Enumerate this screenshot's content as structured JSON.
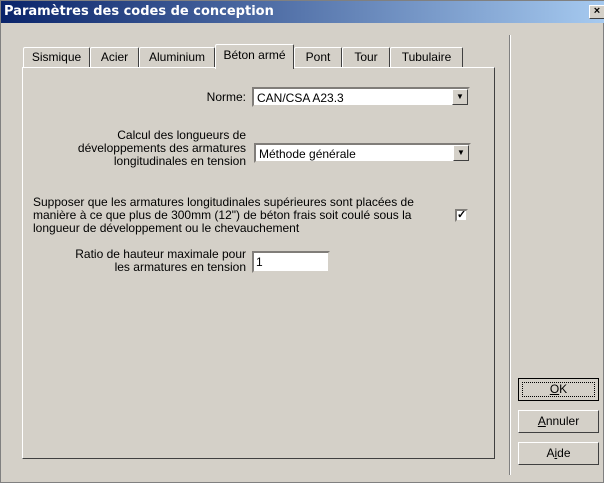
{
  "window": {
    "title": "Paramètres des codes de conception",
    "close_glyph": "×"
  },
  "tabs": [
    "Sismique",
    "Acier",
    "Aluminium",
    "Béton armé",
    "Pont",
    "Tour",
    "Tubulaire"
  ],
  "active_tab": "Béton armé",
  "form": {
    "norme_label": "Norme:",
    "norme_value": "CAN/CSA A23.3",
    "calc_label_lines": [
      "Calcul des longueurs de",
      "développements des armatures",
      "longitudinales en tension"
    ],
    "calc_value": "Méthode générale",
    "suppose_text_lines": [
      "Supposer que les armatures longitudinales supérieures sont placées de",
      "manière à ce que plus de 300mm (12\") de béton frais soit coulé sous la",
      "longueur de développement ou le chevauchement"
    ],
    "suppose_checked": true,
    "ratio_label_lines": [
      "Ratio de hauteur maximale pour",
      "les armatures en tension"
    ],
    "ratio_value": "1"
  },
  "buttons": {
    "ok": {
      "pre": "",
      "mnemonic": "O",
      "post": "K"
    },
    "cancel": {
      "pre": "",
      "mnemonic": "A",
      "post": "nnuler"
    },
    "help": {
      "pre": "A",
      "mnemonic": "i",
      "post": "de"
    }
  },
  "icons": {
    "dropdown": "chevron-down-icon",
    "check": "checkmark-icon"
  }
}
